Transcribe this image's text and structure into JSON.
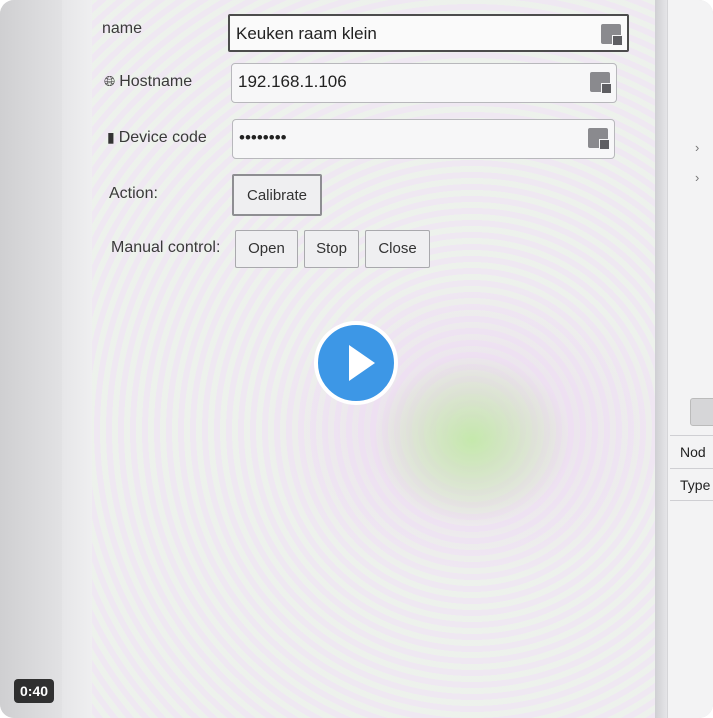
{
  "form": {
    "name_label": "name",
    "name_value": "Keuken raam klein",
    "hostname_label": "Hostname",
    "hostname_value": "192.168.1.106",
    "device_code_label": "Device code",
    "device_code_value": "••••••••",
    "action_label": "Action:",
    "calibrate_label": "Calibrate",
    "manual_control_label": "Manual control:",
    "open_label": "Open",
    "stop_label": "Stop",
    "close_label": "Close"
  },
  "sidebar": {
    "node_label": "Nod",
    "type_label": "Type"
  },
  "video": {
    "timestamp": "0:40",
    "accent_color": "#3d97e6"
  }
}
